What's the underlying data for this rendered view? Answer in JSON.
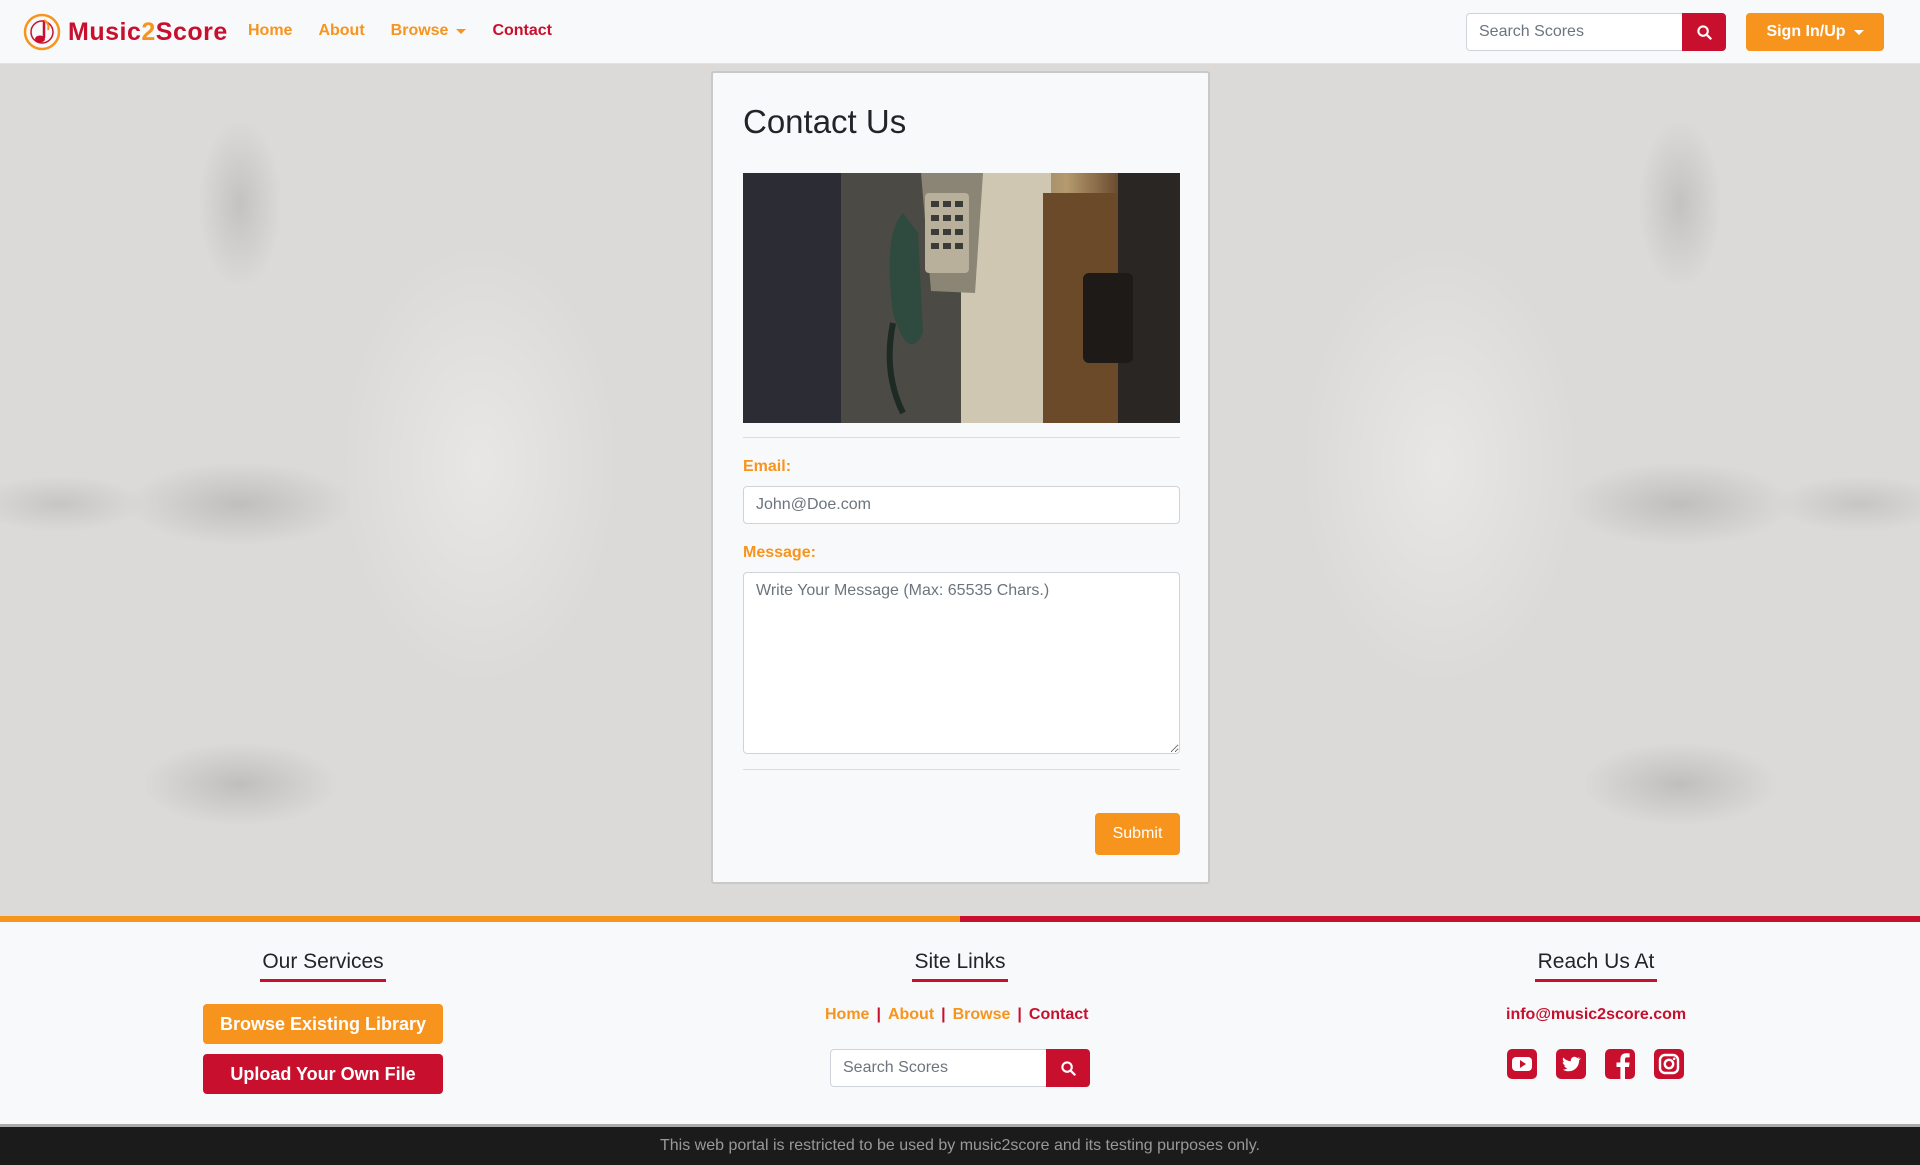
{
  "brand": {
    "part1": "Music",
    "part2": "2",
    "part3": "Score"
  },
  "nav": {
    "home": "Home",
    "about": "About",
    "browse": "Browse",
    "contact": "Contact",
    "search_placeholder": "Search Scores",
    "signin": "Sign In/Up"
  },
  "contact": {
    "title": "Contact Us",
    "email_label": "Email:",
    "email_placeholder": "John@Doe.com",
    "message_label": "Message:",
    "message_placeholder": "Write Your Message (Max: 65535 Chars.)",
    "submit": "Submit"
  },
  "footer": {
    "services_title": "Our Services",
    "browse_library": "Browse Existing Library",
    "upload_file": "Upload Your Own File",
    "sitelinks_title": "Site Links",
    "links": {
      "home": "Home",
      "about": "About",
      "browse": "Browse",
      "contact": "Contact",
      "sep": "|"
    },
    "search_placeholder": "Search Scores",
    "reach_title": "Reach Us At",
    "email": "info@music2score.com",
    "social_icons": [
      "youtube-icon",
      "twitter-icon",
      "facebook-icon",
      "instagram-icon"
    ]
  },
  "bottom": {
    "notice": "This web portal is restricted to be used by music2score and its testing purposes only."
  },
  "colors": {
    "primary_orange": "#f7941d",
    "primary_red": "#c8102e"
  }
}
